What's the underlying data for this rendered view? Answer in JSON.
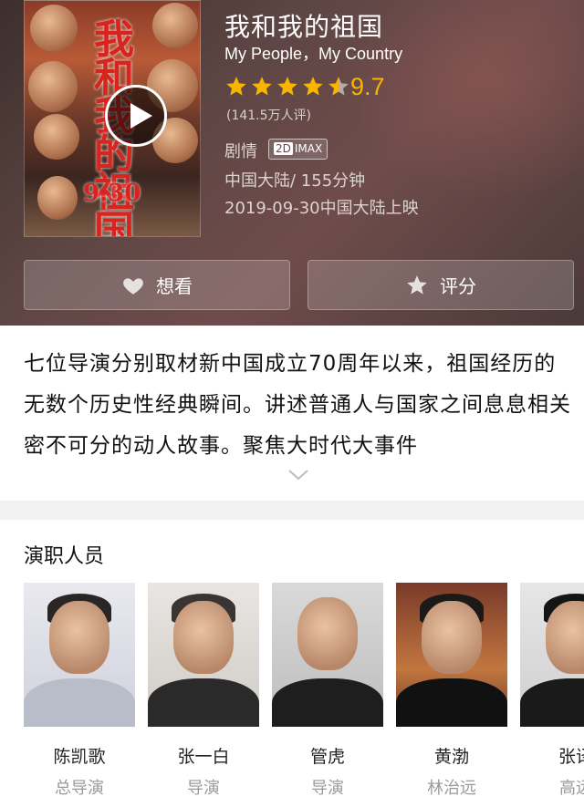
{
  "movie": {
    "title": "我和我的祖国",
    "subtitle": "My People，My Country",
    "rating": 9.7,
    "rating_label": "9.7",
    "stars_filled": 4.5,
    "votes": "(141.5万人评)",
    "genre": "剧情",
    "format_badge": "2D IMAX",
    "region_duration": "中国大陆/ 155分钟",
    "release": "2019-09-30中国大陆上映"
  },
  "poster": {
    "title_text": "我和我的祖国",
    "date_text": "9.30"
  },
  "actions": {
    "want_label": "想看",
    "rate_label": "评分"
  },
  "synopsis": {
    "text": "七位导演分别取材新中国成立70周年以来，祖国经历的无数个历史性经典瞬间。讲述普通人与国家之间息息相关密不可分的动人故事。聚焦大时代大事件"
  },
  "cast": {
    "heading": "演职人员",
    "people": [
      {
        "name": "陈凯歌",
        "role": "总导演"
      },
      {
        "name": "张一白",
        "role": "导演"
      },
      {
        "name": "管虎",
        "role": "导演"
      },
      {
        "name": "黄渤",
        "role": "林治远"
      },
      {
        "name": "张译",
        "role": "高远"
      }
    ]
  },
  "colors": {
    "accent_star": "#f7b500",
    "header_bg": "#5e4644"
  }
}
